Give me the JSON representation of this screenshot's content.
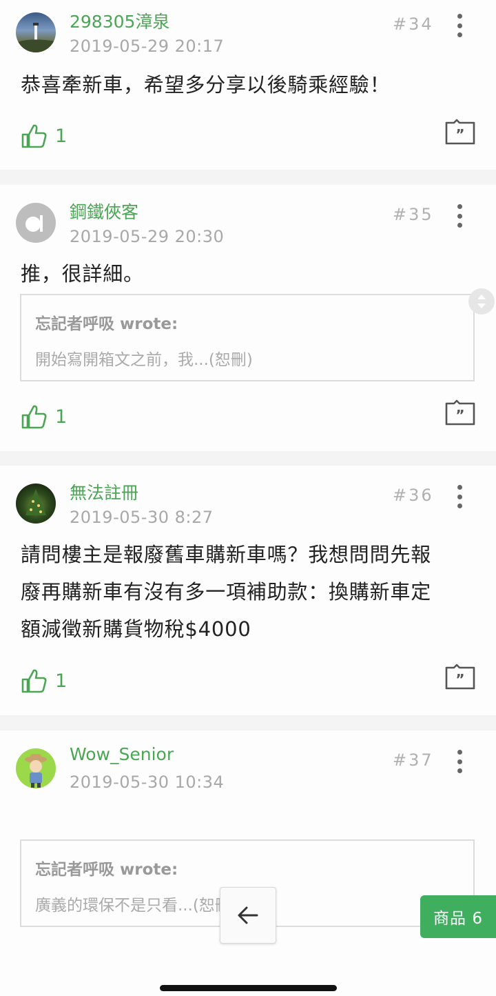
{
  "posts": [
    {
      "username": "298305漳泉",
      "timestamp": "2019-05-29 20:17",
      "floor": "#34",
      "text": "恭喜牽新車，希望多分享以後騎乘經驗！",
      "likes": "1"
    },
    {
      "username": "鋼鐵俠客",
      "timestamp": "2019-05-29 20:30",
      "floor": "#35",
      "text": "推，很詳細。",
      "quote": {
        "author": "忘記者呼吸 wrote:",
        "text": "開始寫開箱文之前，我...(恕刪)"
      },
      "likes": "1"
    },
    {
      "username": "無法註冊",
      "timestamp": "2019-05-30 8:27",
      "floor": "#36",
      "text_lines": [
        "請問樓主是報廢舊車購新車嗎？我想問問先報",
        "廢再購新車有沒有多一項補助款：換購新車定",
        "額減徵新購貨物稅$4000"
      ],
      "likes": "1"
    },
    {
      "username": "Wow_Senior",
      "timestamp": "2019-05-30 10:34",
      "floor": "#37",
      "quote": {
        "author": "忘記者呼吸 wrote:",
        "text": "廣義的環保不是只看...(恕刪)"
      }
    }
  ],
  "product_button": "商品 6",
  "colors": {
    "accent": "#4aa654",
    "product_button": "#3fae5f",
    "separator": "#f4f4f4"
  },
  "icons": {
    "like": "thumbs-up-icon",
    "reply": "quote-reply-icon",
    "more": "more-vertical-icon",
    "back": "arrow-left-icon"
  }
}
